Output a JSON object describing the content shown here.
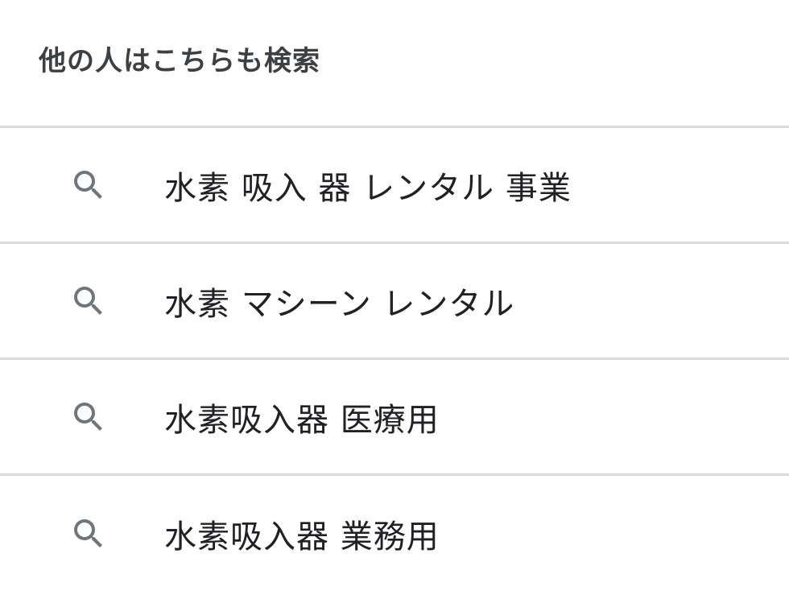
{
  "heading": "他の人はこちらも検索",
  "icon": "search-icon",
  "colors": {
    "icon": "#70757a",
    "divider": "#dadce0",
    "text": "#202124",
    "heading": "#3c4043"
  },
  "suggestions": [
    {
      "label": "水素 吸入 器 レンタル 事業"
    },
    {
      "label": "水素 マシーン レンタル"
    },
    {
      "label": "水素吸入器 医療用"
    },
    {
      "label": "水素吸入器 業務用"
    }
  ]
}
